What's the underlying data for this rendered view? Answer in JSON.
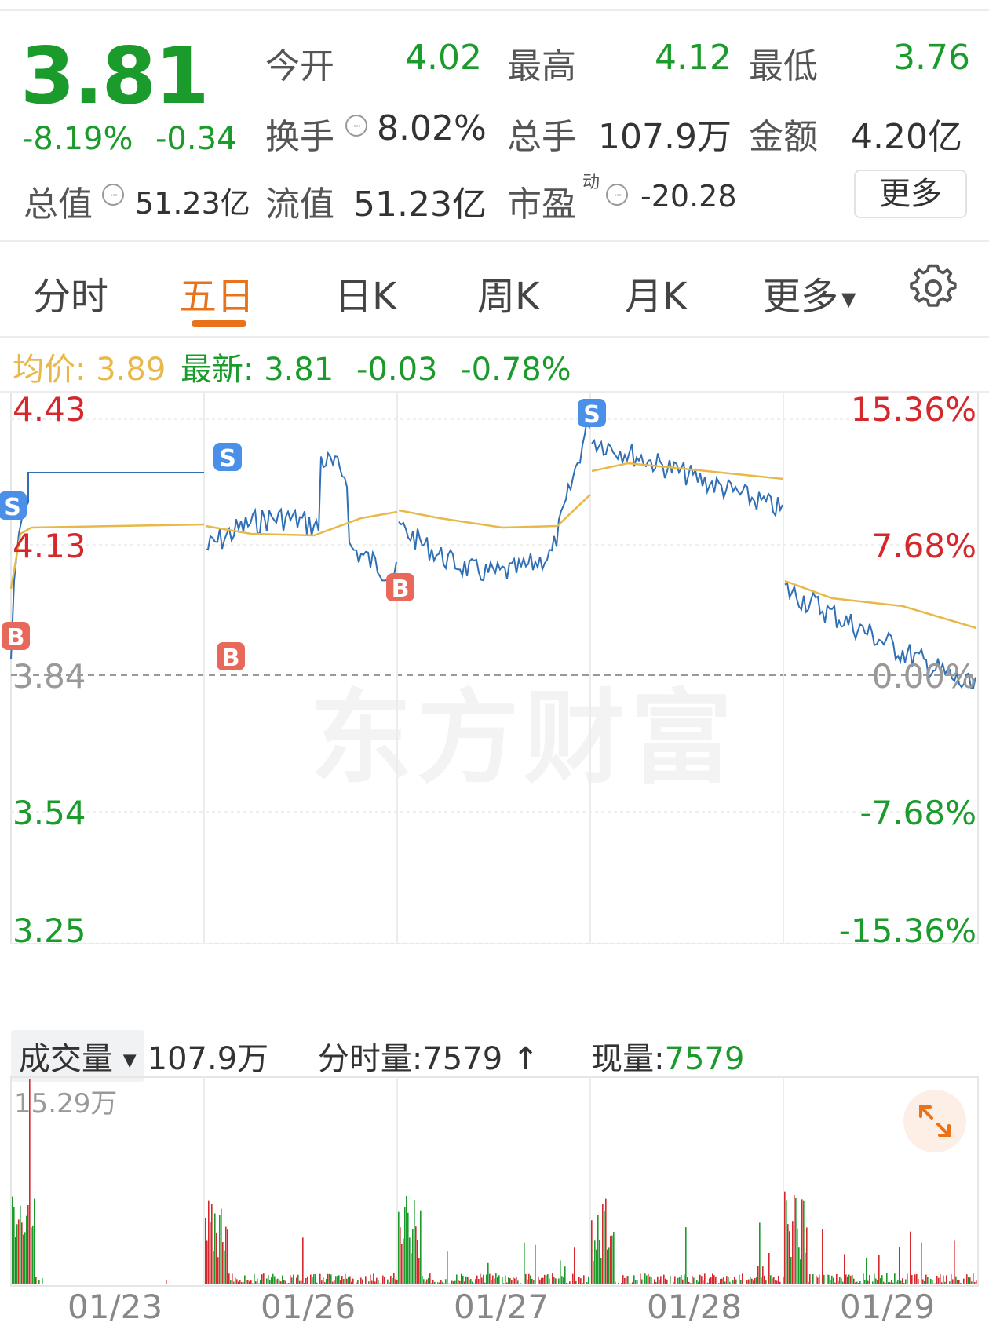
{
  "quote": {
    "price": "3.81",
    "change_pct": "-8.19%",
    "change": "-0.34",
    "open_label": "今开",
    "open": "4.02",
    "high_label": "最高",
    "high": "4.12",
    "low_label": "最低",
    "low": "3.76",
    "turnover_label": "换手",
    "turnover": "8.02%",
    "volume_label": "总手",
    "volume": "107.9万",
    "amount_label": "金额",
    "amount": "4.20亿",
    "mcap_label": "总值",
    "mcap": "51.23亿",
    "float_label": "流值",
    "float": "51.23亿",
    "pe_label": "市盈",
    "pe_sup": "动",
    "pe": "-20.28",
    "more_button": "更多"
  },
  "tabs": [
    {
      "label": "分时"
    },
    {
      "label": "五日"
    },
    {
      "label": "日K"
    },
    {
      "label": "周K"
    },
    {
      "label": "月K"
    },
    {
      "label": "更多"
    }
  ],
  "info_line": {
    "avg_label": "均价:",
    "avg": "3.89",
    "latest_label": "最新:",
    "latest": "3.81",
    "chg": "-0.03",
    "chg_pct": "-0.78%"
  },
  "watermark": "东方财富",
  "chart_data": {
    "type": "line",
    "x": [
      "01/23",
      "01/26",
      "01/27",
      "01/28",
      "01/29"
    ],
    "series": [],
    "ylim": [
      3.25,
      4.43
    ],
    "y_ticks_left": [
      "4.43",
      "4.13",
      "3.84",
      "3.54",
      "3.25"
    ],
    "y_ticks_right": [
      "15.36%",
      "7.68%",
      "0.00%",
      "-7.68%",
      "-15.36%"
    ],
    "markers": [
      {
        "label": "S",
        "day": "01/23"
      },
      {
        "label": "B",
        "day": "01/23"
      },
      {
        "label": "S",
        "day": "01/26"
      },
      {
        "label": "B",
        "day": "01/26"
      },
      {
        "label": "B",
        "day": "01/26"
      },
      {
        "label": "S",
        "day": "01/27"
      }
    ]
  },
  "volume_panel": {
    "select_label": "成交量",
    "total": "107.9万",
    "minute_vol_label": "分时量:",
    "minute_vol": "7579",
    "minute_vol_arrow": "↑",
    "now_vol_label": "现量:",
    "now_vol": "7579",
    "max_label": "15.29万"
  },
  "colors": {
    "up": "#d4282d",
    "down": "#1a9b2b",
    "price_line": "#2f6fb5",
    "avg_line": "#e8b84a",
    "accent": "#e8731a"
  }
}
